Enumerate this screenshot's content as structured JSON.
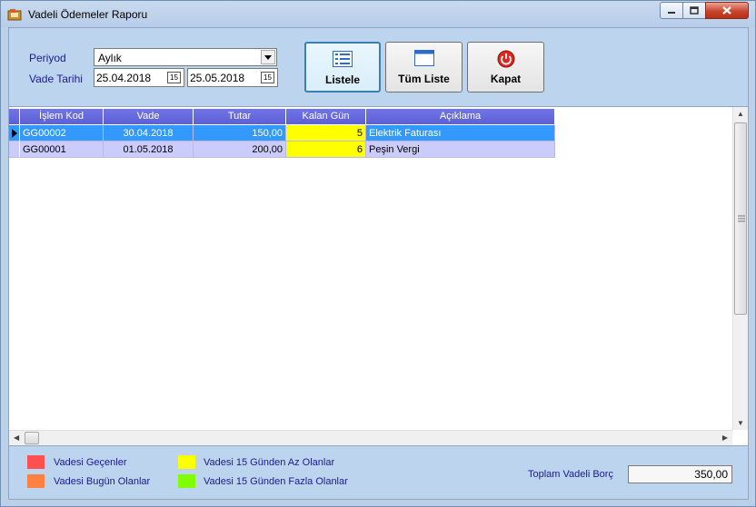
{
  "window": {
    "title": "Vadeli Ödemeler Raporu"
  },
  "filters": {
    "period_label": "Periyod",
    "period_value": "Aylık",
    "due_date_label": "Vade Tarihi",
    "date_from": "25.04.2018",
    "date_to": "25.05.2018",
    "calendar_glyph": "15"
  },
  "buttons": {
    "list": "Listele",
    "all_list": "Tüm Liste",
    "close": "Kapat"
  },
  "table": {
    "columns": [
      "İşlem Kod",
      "Vade",
      "Tutar",
      "Kalan Gün",
      "Açıklama"
    ],
    "rows": [
      {
        "kod": "GG00002",
        "vade": "30.04.2018",
        "tutar": "150,00",
        "kalan": "5",
        "aciklama": "Elektrik Faturası"
      },
      {
        "kod": "GG00001",
        "vade": "01.05.2018",
        "tutar": "200,00",
        "kalan": "6",
        "aciklama": "Peşin Vergi"
      }
    ]
  },
  "legend": {
    "overdue": "Vadesi Geçenler",
    "due_today": "Vadesi Bugün Olanlar",
    "under_15": "Vadesi 15 Günden Az Olanlar",
    "over_15": "Vadesi 15 Günden Fazla Olanlar"
  },
  "total": {
    "label": "Toplam Vadeli Borç",
    "value": "350,00"
  },
  "colors": {
    "overdue": "#ff5050",
    "due_today": "#ff8040",
    "under_15": "#ffff00",
    "over_15": "#80ff00",
    "header": "#5c5fd6",
    "selected_row": "#3399ff"
  }
}
